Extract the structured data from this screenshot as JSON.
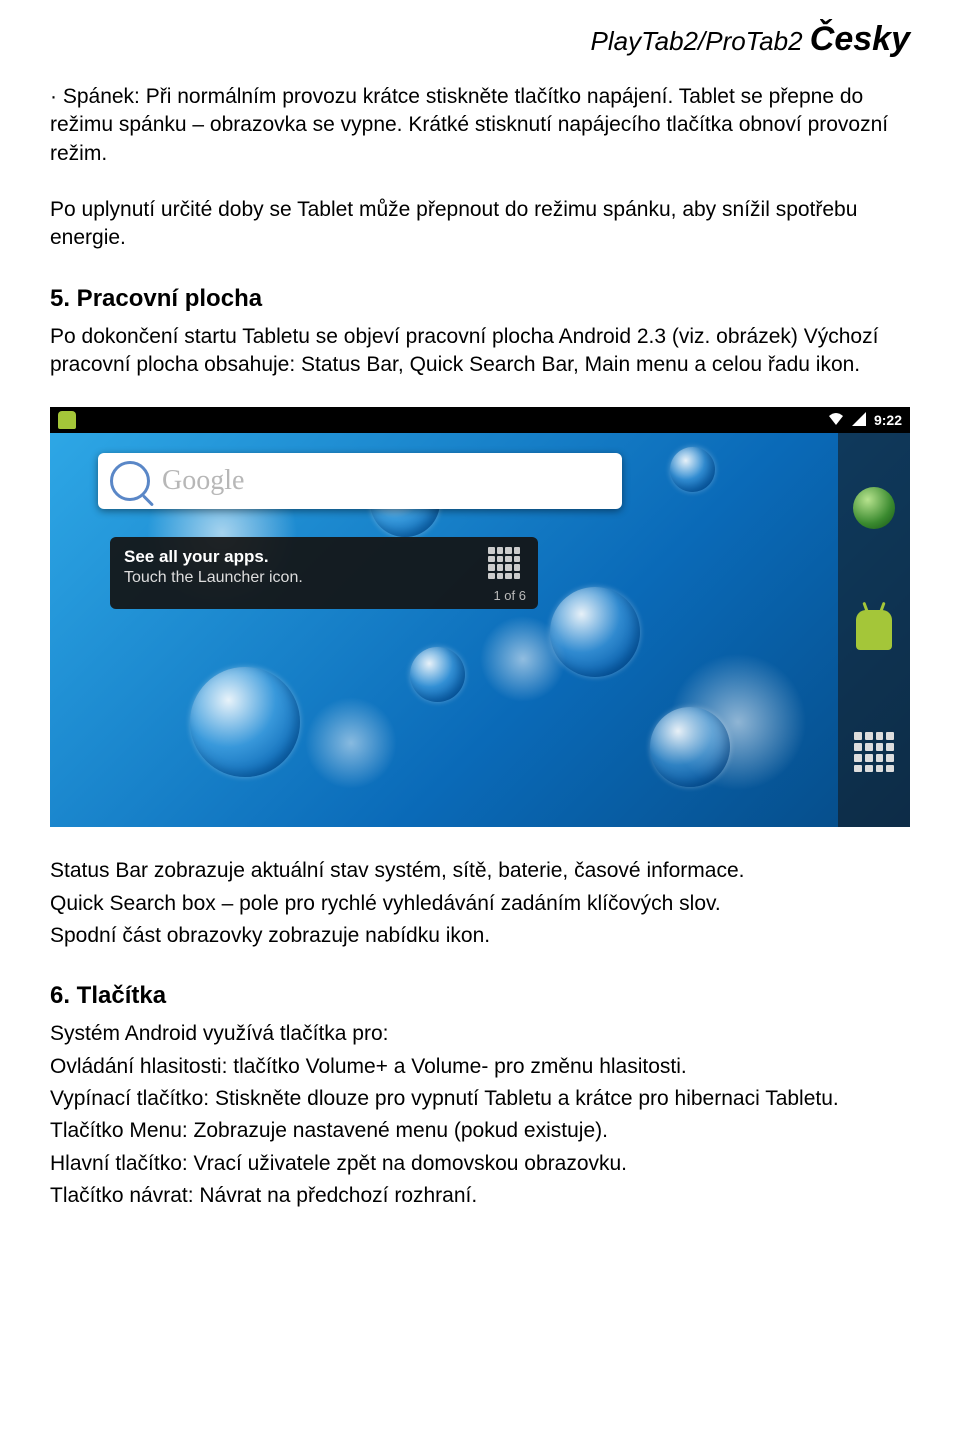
{
  "header": {
    "product": "PlayTab2/ProTab2",
    "language": "Česky"
  },
  "intro": {
    "para1": "· Spánek: Při normálním provozu krátce stiskněte tlačítko napájení. Tablet se přepne do režimu spánku – obrazovka se vypne. Krátké stisknutí napájecího tlačítka obnoví provozní režim.",
    "para2": "Po uplynutí určité doby se Tablet může přepnout do režimu spánku, aby snížil spotřebu energie."
  },
  "section5": {
    "title": "5. Pracovní plocha",
    "p1": "Po dokončení startu Tabletu se objeví pracovní plocha Android 2.3 (viz. obrázek) Výchozí pracovní plocha obsahuje: Status Bar, Quick Search Bar, Main menu a celou řadu ikon."
  },
  "screenshot": {
    "time": "9:22",
    "search_placeholder": "Google",
    "tip_title": "See all your apps.",
    "tip_sub": "Touch the Launcher icon.",
    "page_indicator": "1 of 6"
  },
  "section5b": {
    "l1": "Status Bar zobrazuje aktuální stav systém, sítě, baterie, časové informace.",
    "l2": "Quick Search box – pole pro rychlé vyhledávání zadáním klíčových slov.",
    "l3": "Spodní část obrazovky zobrazuje nabídku ikon."
  },
  "section6": {
    "title": "6. Tlačítka",
    "l1": "Systém Android využívá tlačítka pro:",
    "l2": "Ovládání hlasitosti: tlačítko Volume+ a Volume- pro změnu hlasitosti.",
    "l3": "Vypínací tlačítko: Stiskněte dlouze pro vypnutí Tabletu a krátce pro hibernaci Tabletu.",
    "l4": "Tlačítko Menu: Zobrazuje nastavené menu (pokud existuje).",
    "l5": "Hlavní tlačítko: Vrací uživatele zpět na domovskou obrazovku.",
    "l6": "Tlačítko návrat: Návrat na předchozí rozhraní."
  }
}
